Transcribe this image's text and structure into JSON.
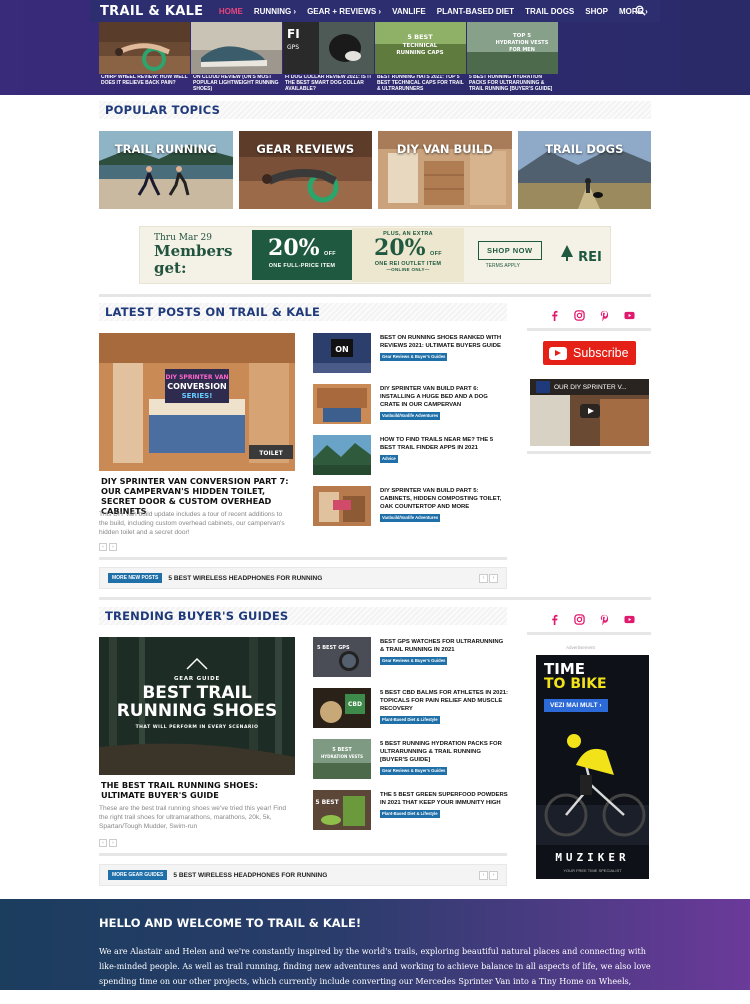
{
  "brand": {
    "logo": "TRAIL & KALE"
  },
  "nav": {
    "items": [
      "HOME",
      "RUNNING ›",
      "GEAR + REVIEWS ›",
      "VANLIFE",
      "PLANT-BASED DIET",
      "TRAIL DOGS",
      "SHOP",
      "MORE ›"
    ],
    "active_color": "#e8447a"
  },
  "strip": [
    {
      "title": "CHIRP WHEEL REVIEW: HOW WELL DOES IT RELIEVE BACK PAIN?"
    },
    {
      "title": "ON CLOUD REVIEW (ON'S MOST POPULAR LIGHTWEIGHT RUNNING SHOES)"
    },
    {
      "title": "FI DOG COLLAR REVIEW 2021: IS IT THE BEST SMART DOG COLLAR AVAILABLE?"
    },
    {
      "title": "BEST RUNNING HATS 2021: TOP 5 BEST TECHNICAL CAPS FOR TRAIL & ULTRARUNNERS"
    },
    {
      "title": "5 BEST RUNNING HYDRATION PACKS FOR ULTRARUNNING & TRAIL RUNNING [BUYER'S GUIDE]"
    }
  ],
  "popular": {
    "heading": "POPULAR TOPICS",
    "topics": [
      "TRAIL RUNNING",
      "GEAR REVIEWS",
      "DIY VAN BUILD",
      "TRAIL DOGS"
    ]
  },
  "ad": {
    "line1": "Thru Mar 29",
    "line2": "Members get:",
    "pct1": "20%",
    "off": "OFF",
    "sub1": "ONE FULL-PRICE ITEM",
    "extra": "PLUS, AN EXTRA",
    "pct2": "20%",
    "sub2": "ONE REI OUTLET ITEM",
    "online": "—ONLINE ONLY—",
    "shop": "SHOP NOW",
    "terms": "TERMS APPLY",
    "brand": "REI"
  },
  "latest": {
    "heading": "LATEST POSTS ON TRAIL & KALE",
    "featured_title": "DIY SPRINTER VAN CONVERSION PART 7: OUR CAMPERVAN'S HIDDEN TOILET, SECRET DOOR & CUSTOM OVERHEAD CABINETS",
    "featured_excerpt": "This DIY van build update includes a tour of recent additions to the build, including custom overhead cabinets, our campervan's hidden toilet and a secret door!",
    "items": [
      {
        "title": "BEST ON RUNNING SHOES RANKED WITH REVIEWS 2021: ULTIMATE BUYERS GUIDE",
        "cat": "Gear Reviews & Buyer's Guides"
      },
      {
        "title": "DIY SPRINTER VAN BUILD PART 6: INSTALLING A HUGE BED AND A DOG CRATE IN OUR CAMPERVAN",
        "cat": "Vanbuild/Vanlife Adventures"
      },
      {
        "title": "HOW TO FIND TRAILS NEAR ME? THE 5 BEST TRAIL FINDER APPS IN 2021",
        "cat": "Advice"
      },
      {
        "title": "DIY SPRINTER VAN BUILD PART 5: CABINETS, HIDDEN COMPOSTING TOILET, OAK COUNTERTOP AND MORE",
        "cat": "Vanbuild/Vanlife Adventures"
      }
    ],
    "ticker_badge": "MORE NEW POSTS",
    "ticker_text": "5 BEST WIRELESS HEADPHONES FOR RUNNING"
  },
  "trending": {
    "heading": "TRENDING BUYER'S GUIDES",
    "featured_small": "GEAR GUIDE",
    "featured_img_line1": "BEST TRAIL",
    "featured_img_line2": "RUNNING SHOES",
    "featured_img_sub": "THAT WILL PERFORM IN EVERY SCENARIO",
    "featured_title": "THE BEST TRAIL RUNNING SHOES: ULTIMATE BUYER'S GUIDE",
    "featured_excerpt": "These are the best trail running shoes we've tried this year! Find the right trail shoes for ultramarathons, marathons, 20k, 5k, Spartan/Tough Mudder, Swim-run",
    "items": [
      {
        "title": "BEST GPS WATCHES FOR ULTRARUNNING & TRAIL RUNNING IN 2021",
        "cat": "Gear Reviews & Buyer's Guides"
      },
      {
        "title": "5 BEST CBD BALMS FOR ATHLETES IN 2021: TOPICALS FOR PAIN RELIEF AND MUSCLE RECOVERY",
        "cat": "Plant-Based Diet & Lifestyle"
      },
      {
        "title": "5 BEST RUNNING HYDRATION PACKS FOR ULTRARUNNING & TRAIL RUNNING [BUYER'S GUIDE]",
        "cat": "Gear Reviews & Buyer's Guides"
      },
      {
        "title": "THE 5 BEST GREEN SUPERFOOD POWDERS IN 2021 THAT KEEP YOUR IMMUNITY HIGH",
        "cat": "Plant-Based Diet & Lifestyle"
      }
    ],
    "ticker_badge": "MORE GEAR GUIDES",
    "ticker_text": "5 BEST WIRELESS HEADPHONES FOR RUNNING"
  },
  "sidebar": {
    "subscribe": "Subscribe",
    "video_title": "OUR DIY SPRINTER V...",
    "ad_label": "Advertisement",
    "ad_line1": "TIME",
    "ad_line2": "TO BIKE",
    "ad_button": "VEZI MAI MULT ›",
    "ad_brand": "MUZIKER",
    "ad_tagline": "YOUR FREE TIME SPECIALIST"
  },
  "welcome": {
    "heading": "HELLO AND WELCOME TO TRAIL & KALE!",
    "body": "We are Alastair and Helen and we're constantly inspired by the world's trails, exploring beautiful natural places and connecting with like-minded people. As well as trail running, finding new adventures and working to achieve balance in all aspects of life, we also love spending time on our other projects, which currently include converting our Mercedes Sprinter Van into a Tiny Home on Wheels, training our young Border Collie Kepler, and"
  }
}
